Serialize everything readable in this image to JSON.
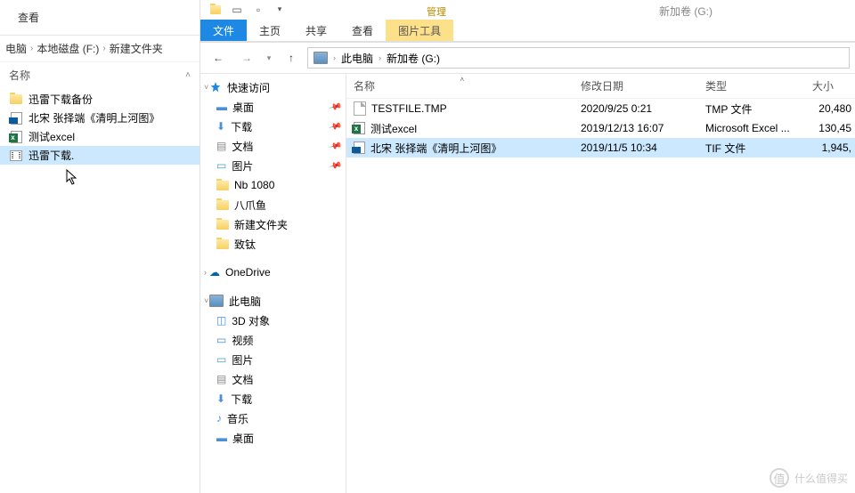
{
  "left_window": {
    "tab": "查看",
    "breadcrumb": [
      "电脑",
      "本地磁盘 (F:)",
      "新建文件夹"
    ],
    "header": "名称",
    "items": [
      {
        "icon": "folder",
        "label": "迅雷下载备份"
      },
      {
        "icon": "tif",
        "label": "北宋 张择端《清明上河图》"
      },
      {
        "icon": "excel",
        "label": "测试excel"
      },
      {
        "icon": "video",
        "label": "迅雷下载."
      }
    ],
    "selected_index": 3
  },
  "right_window": {
    "title": "新加卷 (G:)",
    "ribbon": {
      "file": "文件",
      "tabs": [
        "主页",
        "共享",
        "查看"
      ],
      "contextual_head": "管理",
      "contextual": "图片工具"
    },
    "nav": {
      "breadcrumb_root": "此电脑",
      "breadcrumb_item": "新加卷 (G:)"
    },
    "tree": {
      "quick_access": "快速访问",
      "qa_items": [
        {
          "icon": "desktop",
          "label": "桌面",
          "pinned": true
        },
        {
          "icon": "download",
          "label": "下载",
          "pinned": true
        },
        {
          "icon": "doc",
          "label": "文档",
          "pinned": true
        },
        {
          "icon": "picture",
          "label": "图片",
          "pinned": true
        },
        {
          "icon": "folder",
          "label": "Nb 1080",
          "pinned": false
        },
        {
          "icon": "folder",
          "label": "八爪鱼",
          "pinned": false
        },
        {
          "icon": "folder",
          "label": "新建文件夹",
          "pinned": false
        },
        {
          "icon": "folder",
          "label": "致钛",
          "pinned": false
        }
      ],
      "onedrive": "OneDrive",
      "this_pc": "此电脑",
      "pc_items": [
        {
          "icon": "3d",
          "label": "3D 对象"
        },
        {
          "icon": "video",
          "label": "视频"
        },
        {
          "icon": "picture",
          "label": "图片"
        },
        {
          "icon": "doc",
          "label": "文档"
        },
        {
          "icon": "download",
          "label": "下载"
        },
        {
          "icon": "music",
          "label": "音乐"
        },
        {
          "icon": "desktop",
          "label": "桌面"
        }
      ]
    },
    "columns": {
      "name": "名称",
      "date": "修改日期",
      "type": "类型",
      "size": "大小"
    },
    "files": [
      {
        "icon": "file",
        "name": "TESTFILE.TMP",
        "date": "2020/9/25 0:21",
        "type": "TMP 文件",
        "size": "20,480"
      },
      {
        "icon": "excel",
        "name": "测试excel",
        "date": "2019/12/13 16:07",
        "type": "Microsoft Excel ...",
        "size": "130,45"
      },
      {
        "icon": "tif",
        "name": "北宋 张择端《清明上河图》",
        "date": "2019/11/5 10:34",
        "type": "TIF 文件",
        "size": "1,945,"
      }
    ],
    "selected_file": 2
  },
  "watermark": "什么值得买"
}
